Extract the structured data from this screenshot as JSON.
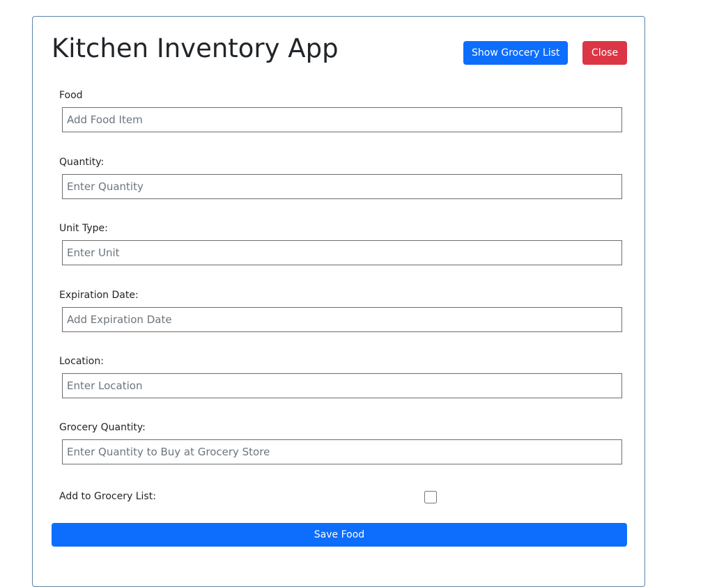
{
  "app": {
    "title": "Kitchen Inventory App"
  },
  "header": {
    "grocery_button_label": "Show Grocery List",
    "close_button_label": "Close"
  },
  "form": {
    "fields": [
      {
        "label": "Food",
        "value": "",
        "placeholder": "Add Food Item"
      },
      {
        "label": "Quantity:",
        "value": "",
        "placeholder": "Enter Quantity"
      },
      {
        "label": "Unit Type:",
        "value": "",
        "placeholder": "Enter Unit"
      },
      {
        "label": "Expiration Date:",
        "value": "",
        "placeholder": "Add Expiration Date"
      },
      {
        "label": "Location:",
        "value": "",
        "placeholder": "Enter Location"
      },
      {
        "label": "Grocery Quantity:",
        "value": "",
        "placeholder": "Enter Quantity to Buy at Grocery Store"
      }
    ],
    "grocery_checkbox": {
      "label": "Add to Grocery List:",
      "checked": false
    },
    "save_button_label": "Save Food"
  },
  "colors": {
    "primary": "#0d6efd",
    "danger": "#dc3545",
    "card_border": "#5b84a8"
  }
}
